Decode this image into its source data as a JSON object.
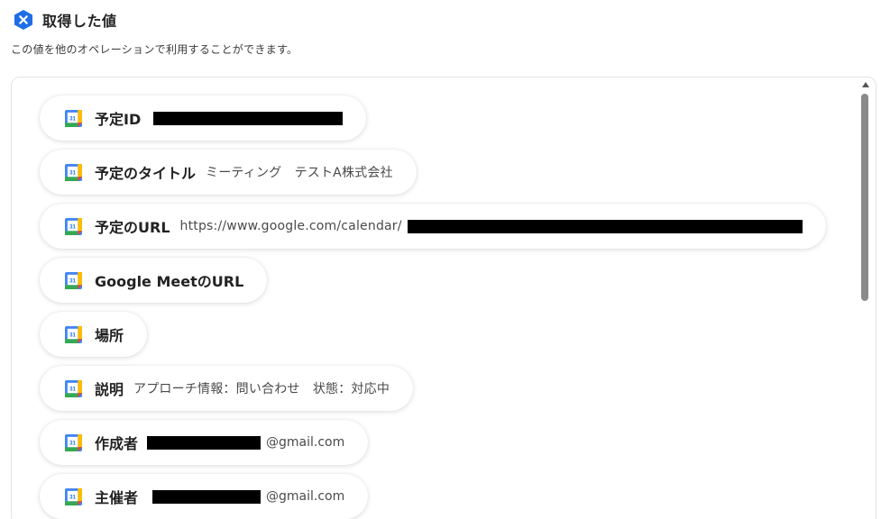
{
  "header": {
    "title": "取得した値",
    "description": "この値を他のオペレーションで利用することができます。",
    "app_icon": "yoom-x-icon",
    "accent": "#1e6ee6"
  },
  "items": [
    {
      "label": "予定ID",
      "value": "",
      "redacted": true,
      "suffix": ""
    },
    {
      "label": "予定のタイトル",
      "value": "ミーティング　テストA株式会社",
      "redacted": false,
      "suffix": ""
    },
    {
      "label": "予定のURL",
      "value": "https://www.google.com/calendar/",
      "redacted": true,
      "suffix": ""
    },
    {
      "label": "Google MeetのURL",
      "value": "",
      "redacted": false,
      "suffix": ""
    },
    {
      "label": "場所",
      "value": "",
      "redacted": false,
      "suffix": ""
    },
    {
      "label": "説明",
      "value": "アプローチ情報：問い合わせ　状態：対応中",
      "redacted": false,
      "suffix": ""
    },
    {
      "label": "作成者",
      "value": "",
      "redacted": true,
      "suffix": "@gmail.com"
    },
    {
      "label": "主催者",
      "value": "",
      "redacted": true,
      "suffix": "@gmail.com"
    }
  ],
  "icons": {
    "item_icon": "google-calendar-icon",
    "calendar_day": "31"
  }
}
